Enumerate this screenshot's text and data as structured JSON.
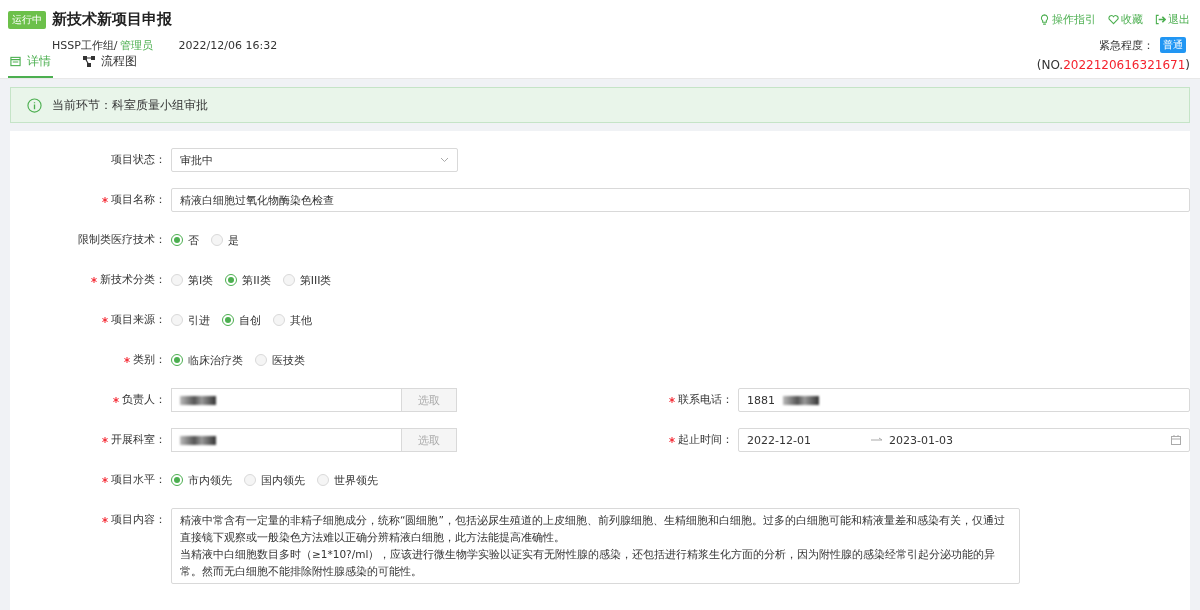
{
  "header": {
    "status_badge": "运行中",
    "title": "新技术新项目申报",
    "group": "HSSP工作组/",
    "role": "管理员",
    "datetime": "2022/12/06 16:32",
    "actions": [
      {
        "label": "操作指引",
        "kind": "bulb"
      },
      {
        "label": "收藏",
        "kind": "heart"
      },
      {
        "label": "退出",
        "kind": "exit"
      }
    ],
    "urgency_label": "紧急程度：",
    "urgency": "普通",
    "number_prefix": "(NO.",
    "number": "2022120616321671",
    "number_suffix": ")"
  },
  "tabs": [
    {
      "label": "详情",
      "kind": "detail",
      "selected": true
    },
    {
      "label": "流程图",
      "kind": "flow",
      "selected": false
    }
  ],
  "alert": "当前环节：科室质量小组审批",
  "form": [
    {
      "fields": [
        {
          "label": "项目状态：",
          "required": false,
          "kind": "select",
          "value": "审批中"
        }
      ]
    },
    {
      "fields": [
        {
          "label": "项目名称：",
          "required": true,
          "kind": "input",
          "value": "精液白细胞过氧化物酶染色检查"
        }
      ]
    },
    {
      "fields": [
        {
          "label": "限制类医疗技术：",
          "required": false,
          "kind": "radio",
          "options": [
            {
              "label": "否",
              "selected": true
            },
            {
              "label": "是",
              "selected": false
            }
          ]
        }
      ]
    },
    {
      "fields": [
        {
          "label": "新技术分类：",
          "required": true,
          "kind": "radio",
          "options": [
            {
              "label": "第I类",
              "selected": false
            },
            {
              "label": "第II类",
              "selected": true
            },
            {
              "label": "第III类",
              "selected": false
            }
          ]
        }
      ]
    },
    {
      "fields": [
        {
          "label": "项目来源：",
          "required": true,
          "kind": "radio",
          "options": [
            {
              "label": "引进",
              "selected": false
            },
            {
              "label": "自创",
              "selected": true
            },
            {
              "label": "其他",
              "selected": false
            }
          ]
        }
      ]
    },
    {
      "fields": [
        {
          "label": "类别：",
          "required": true,
          "kind": "radio",
          "options": [
            {
              "label": "临床治疗类",
              "selected": true
            },
            {
              "label": "医技类",
              "selected": false
            }
          ]
        }
      ]
    },
    {
      "fields": [
        {
          "label": "负责人：",
          "required": true,
          "kind": "picker",
          "redacted": true,
          "button": "选取"
        },
        {
          "label": "联系电话：",
          "required": true,
          "kind": "input",
          "value": "1881",
          "redacted": true
        }
      ]
    },
    {
      "fields": [
        {
          "label": "开展科室：",
          "required": true,
          "kind": "picker",
          "redacted": true,
          "button": "选取"
        },
        {
          "label": "起止时间：",
          "required": true,
          "kind": "date_range",
          "start": "2022-12-01",
          "end": "2023-01-03"
        }
      ]
    },
    {
      "fields": [
        {
          "label": "项目水平：",
          "required": true,
          "kind": "radio",
          "options": [
            {
              "label": "市内领先",
              "selected": true
            },
            {
              "label": "国内领先",
              "selected": false
            },
            {
              "label": "世界领先",
              "selected": false
            }
          ]
        }
      ]
    },
    {
      "fields": [
        {
          "label": "项目内容：",
          "required": true,
          "kind": "textarea",
          "paragraphs": [
            "精液中常含有一定量的非精子细胞成分，统称“圆细胞”，包括泌尿生殖道的上皮细胞、前列腺细胞、生精细胞和白细胞。过多的白细胞可能和精液量差和感染有关，仅通过直接镜下观察或一般染色方法难以正确分辨精液白细胞，此方法能提高准确性。",
            "当精液中白细胞数目多时（≥1*10?/ml），应该进行微生物学实验以证实有无附性腺的感染，还包括进行精浆生化方面的分析，因为附性腺的感染经常引起分泌功能的异常。然而无白细胞不能排除附性腺感染的可能性。"
          ]
        }
      ]
    }
  ]
}
